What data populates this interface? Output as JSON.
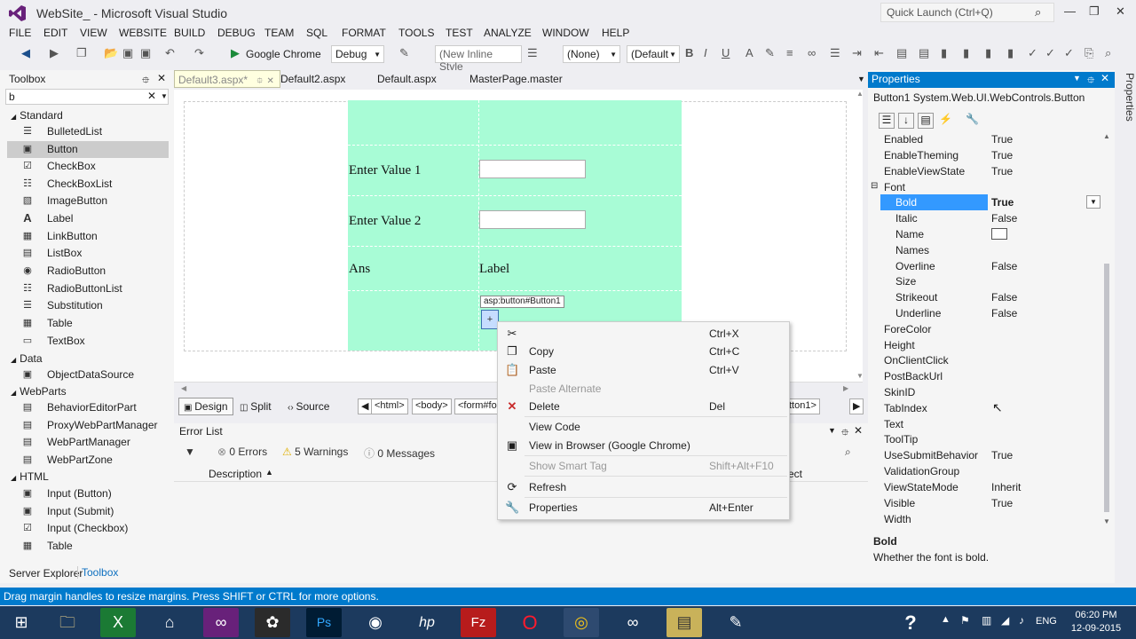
{
  "title_bar": {
    "title": "WebSite_ - Microsoft Visual Studio",
    "quick_launch": "Quick Launch (Ctrl+Q)"
  },
  "menu": [
    "FILE",
    "EDIT",
    "VIEW",
    "WEBSITE",
    "BUILD",
    "DEBUG",
    "TEAM",
    "SQL",
    "FORMAT",
    "TOOLS",
    "TEST",
    "ANALYZE",
    "WINDOW",
    "HELP"
  ],
  "toolbar": {
    "browser": "Google Chrome",
    "config": "Debug",
    "inline_style": "(New Inline Style",
    "none": "(None)",
    "default": "(Default"
  },
  "toolbox": {
    "title": "Toolbox",
    "search": "b",
    "groups": {
      "standard": "Standard",
      "data": "Data",
      "webparts": "WebParts",
      "html": "HTML"
    },
    "standard_items": [
      "BulletedList",
      "Button",
      "CheckBox",
      "CheckBoxList",
      "ImageButton",
      "Label",
      "LinkButton",
      "ListBox",
      "RadioButton",
      "RadioButtonList",
      "Substitution",
      "Table",
      "TextBox"
    ],
    "data_items": [
      "ObjectDataSource"
    ],
    "webparts_items": [
      "BehaviorEditorPart",
      "ProxyWebPartManager",
      "WebPartManager",
      "WebPartZone"
    ],
    "html_items": [
      "Input (Button)",
      "Input (Submit)",
      "Input (Checkbox)",
      "Table"
    ],
    "bottom_tabs": {
      "server_explorer": "Server Explorer",
      "toolbox": "Toolbox"
    }
  },
  "doc_tabs": [
    "Default3.aspx*",
    "Default2.aspx",
    "Default.aspx",
    "MasterPage.master"
  ],
  "design": {
    "row1_label": "Enter Value 1",
    "row2_label": "Enter Value 2",
    "row3_label": "Ans",
    "row3_value": "Label",
    "button_tag": "asp:button#Button1",
    "button_glyph": "+"
  },
  "view_bar": {
    "design": "Design",
    "split": "Split",
    "source": "Source",
    "crumbs": [
      "<html>",
      "<body>",
      "<form#fo"
    ],
    "crumb_end": "tton1>"
  },
  "error_list": {
    "title": "Error List",
    "errors": "0 Errors",
    "warnings": "5 Warnings",
    "messages": "0 Messages",
    "col_description": "Description",
    "col_project": "ect"
  },
  "properties": {
    "title": "Properties",
    "object": "Button1  System.Web.UI.WebControls.Button",
    "rows": [
      {
        "name": "Enabled",
        "value": "True"
      },
      {
        "name": "EnableTheming",
        "value": "True"
      },
      {
        "name": "EnableViewState",
        "value": "True"
      },
      {
        "name": "Font",
        "value": ""
      },
      {
        "name": "Bold",
        "value": "True"
      },
      {
        "name": "Italic",
        "value": "False"
      },
      {
        "name": "Name",
        "value": ""
      },
      {
        "name": "Names",
        "value": ""
      },
      {
        "name": "Overline",
        "value": "False"
      },
      {
        "name": "Size",
        "value": ""
      },
      {
        "name": "Strikeout",
        "value": "False"
      },
      {
        "name": "Underline",
        "value": "False"
      },
      {
        "name": "ForeColor",
        "value": ""
      },
      {
        "name": "Height",
        "value": ""
      },
      {
        "name": "OnClientClick",
        "value": ""
      },
      {
        "name": "PostBackUrl",
        "value": ""
      },
      {
        "name": "SkinID",
        "value": ""
      },
      {
        "name": "TabIndex",
        "value": ""
      },
      {
        "name": "Text",
        "value": ""
      },
      {
        "name": "ToolTip",
        "value": ""
      },
      {
        "name": "UseSubmitBehavior",
        "value": "True"
      },
      {
        "name": "ValidationGroup",
        "value": ""
      },
      {
        "name": "ViewStateMode",
        "value": "Inherit"
      },
      {
        "name": "Visible",
        "value": "True"
      },
      {
        "name": "Width",
        "value": ""
      }
    ],
    "desc_title": "Bold",
    "desc_text": "Whether the font is bold.",
    "side_tab": "Properties"
  },
  "context_menu": [
    {
      "label": "",
      "shortcut": "Ctrl+X",
      "icon": "cut-icon",
      "disabled": false
    },
    {
      "label": "Copy",
      "shortcut": "Ctrl+C",
      "icon": "copy-icon",
      "disabled": false
    },
    {
      "label": "Paste",
      "shortcut": "Ctrl+V",
      "icon": "paste-icon",
      "disabled": false
    },
    {
      "label": "Paste Alternate",
      "shortcut": "",
      "icon": "",
      "disabled": true
    },
    {
      "label": "Delete",
      "shortcut": "Del",
      "icon": "delete-icon",
      "disabled": false
    },
    {
      "label": "View Code",
      "shortcut": "",
      "icon": "",
      "disabled": false
    },
    {
      "label": "View in Browser (Google Chrome)",
      "shortcut": "",
      "icon": "browser-icon",
      "disabled": false
    },
    {
      "label": "Show Smart Tag",
      "shortcut": "Shift+Alt+F10",
      "icon": "",
      "disabled": true
    },
    {
      "label": "Refresh",
      "shortcut": "",
      "icon": "refresh-icon",
      "disabled": false
    },
    {
      "label": "Properties",
      "shortcut": "Alt+Enter",
      "icon": "wrench-icon",
      "disabled": false
    }
  ],
  "status_bar": "Drag margin handles to resize margins. Press SHIFT or CTRL for more options.",
  "taskbar": {
    "lang": "ENG",
    "time": "06:20 PM",
    "date": "12-09-2015"
  }
}
